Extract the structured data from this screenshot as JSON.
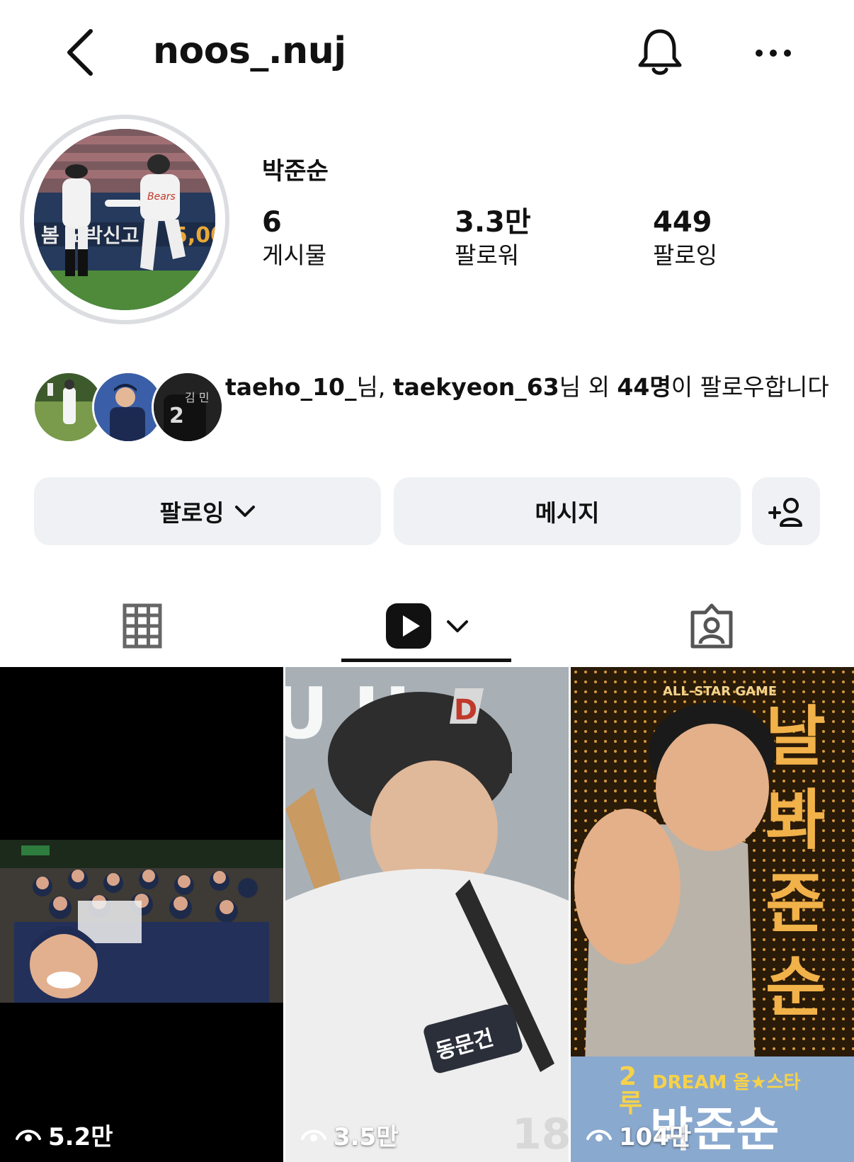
{
  "header": {
    "username": "noos_.nuj"
  },
  "profile": {
    "display_name": "박준순",
    "stats": {
      "posts": {
        "value": "6",
        "label": "게시물"
      },
      "followers": {
        "value": "3.3만",
        "label": "팔로워"
      },
      "following": {
        "value": "449",
        "label": "팔로잉"
      }
    }
  },
  "mutual": {
    "user1": "taeho_10_",
    "suffix1": "님, ",
    "user2": "taekyeon_63",
    "suffix2": "님 외 ",
    "count": "44명",
    "tail": "이 팔로우합니다"
  },
  "actions": {
    "following_label": "팔로잉",
    "message_label": "메시지"
  },
  "tabs": {
    "grid_icon": "grid-icon",
    "reels_icon": "reels-icon",
    "tagged_icon": "tagged-icon",
    "active": "reels"
  },
  "reels": [
    {
      "views": "5.2만"
    },
    {
      "views": "3.5만"
    },
    {
      "views": "104만"
    }
  ],
  "tile_text": {
    "tile3_event": "ALL-STAR GAME",
    "tile3_vertical": "날봐준순",
    "tile3_dream": "DREAM 올★스타",
    "tile3_position": "2루",
    "tile3_name": "박준순"
  },
  "colors": {
    "button_bg": "#eff1f4",
    "avatar_ring": "#dbdde1",
    "text": "#111111"
  }
}
